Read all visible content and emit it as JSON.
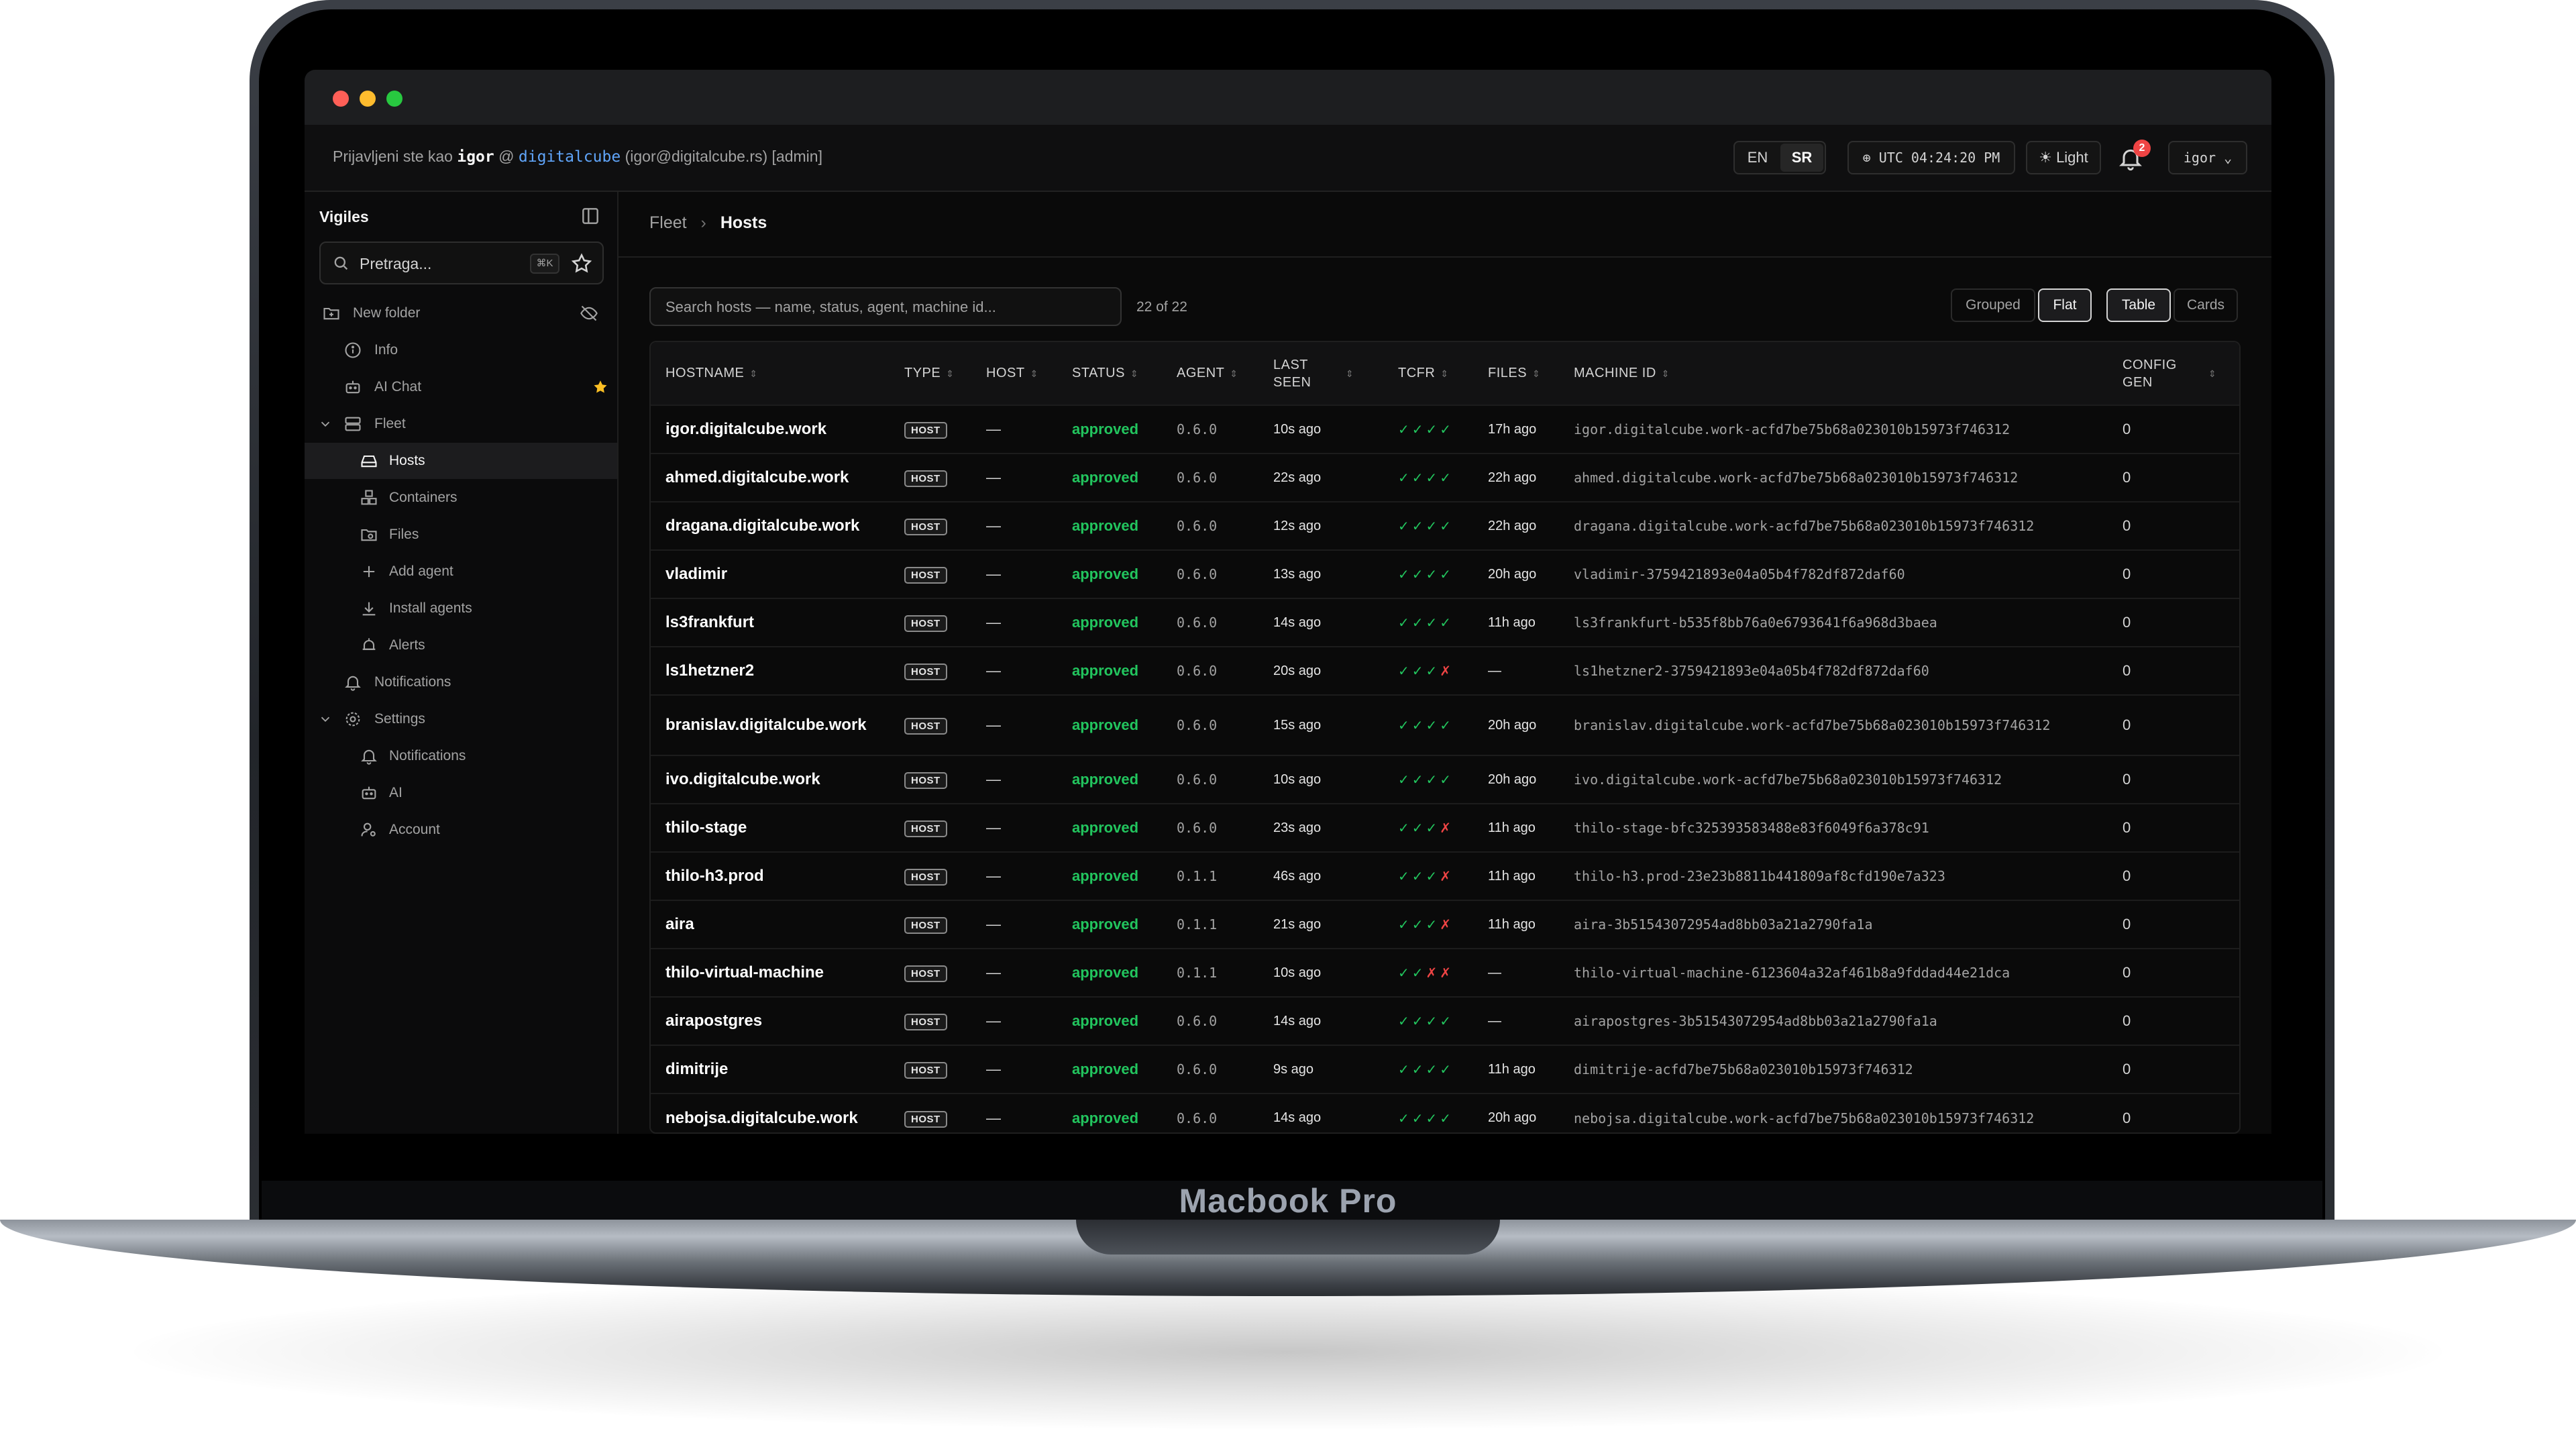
{
  "device": {
    "brand_label": "Macbook Pro"
  },
  "topbar": {
    "login_prefix": "Prijavljeni ste kao",
    "user": "igor",
    "at": "@",
    "org": "digitalcube",
    "email": "(igor@digitalcube.rs)",
    "role": "[admin]",
    "lang_en": "EN",
    "lang_sr": "SR",
    "clock": "UTC 04:24:20 PM",
    "theme": "Light",
    "notifications_count": "2",
    "user_menu": "igor"
  },
  "sidebar": {
    "app_name": "Vigiles",
    "search_placeholder": "Pretraga...",
    "search_shortcut": "⌘K",
    "items": [
      {
        "label": "New folder",
        "icon": "folder-plus-icon"
      },
      {
        "label": "Info",
        "icon": "info-icon"
      },
      {
        "label": "AI Chat",
        "icon": "bot-icon",
        "favorite": true
      },
      {
        "label": "Fleet",
        "icon": "server-icon",
        "expanded": true
      },
      {
        "label": "Hosts",
        "icon": "hard-drive-icon",
        "active": true
      },
      {
        "label": "Containers",
        "icon": "boxes-icon"
      },
      {
        "label": "Files",
        "icon": "folder-search-icon"
      },
      {
        "label": "Add agent",
        "icon": "plus-icon"
      },
      {
        "label": "Install agents",
        "icon": "download-icon"
      },
      {
        "label": "Alerts",
        "icon": "alarm-icon"
      },
      {
        "label": "Notifications",
        "icon": "bell-icon"
      },
      {
        "label": "Settings",
        "icon": "settings-icon",
        "expanded": true
      },
      {
        "label": "Notifications",
        "icon": "bell-icon"
      },
      {
        "label": "AI",
        "icon": "bot-icon"
      },
      {
        "label": "Account",
        "icon": "user-cog-icon"
      }
    ]
  },
  "main": {
    "breadcrumb_parent": "Fleet",
    "breadcrumb_sep": "›",
    "breadcrumb_current": "Hosts",
    "search_placeholder": "Search hosts — name, status, agent, machine id...",
    "count": "22 of 22",
    "view_grouped": "Grouped",
    "view_flat": "Flat",
    "mode_table": "Table",
    "mode_cards": "Cards"
  },
  "table": {
    "columns": [
      "HOSTNAME",
      "TYPE",
      "HOST",
      "STATUS",
      "AGENT",
      "LAST SEEN",
      "TCFR",
      "FILES",
      "MACHINE ID",
      "CONFIG GEN"
    ],
    "rows": [
      {
        "hostname": "igor.digitalcube.work",
        "type": "HOST",
        "host": "—",
        "status": "approved",
        "agent": "0.6.0",
        "last_seen": "10s ago",
        "tcfr": "✓✓✓✓",
        "files": "17h ago",
        "machine_id": "igor.digitalcube.work-acfd7be75b68a023010b15973f746312",
        "config_gen": "0"
      },
      {
        "hostname": "ahmed.digitalcube.work",
        "type": "HOST",
        "host": "—",
        "status": "approved",
        "agent": "0.6.0",
        "last_seen": "22s ago",
        "tcfr": "✓✓✓✓",
        "files": "22h ago",
        "machine_id": "ahmed.digitalcube.work-acfd7be75b68a023010b15973f746312",
        "config_gen": "0"
      },
      {
        "hostname": "dragana.digitalcube.work",
        "type": "HOST",
        "host": "—",
        "status": "approved",
        "agent": "0.6.0",
        "last_seen": "12s ago",
        "tcfr": "✓✓✓✓",
        "files": "22h ago",
        "machine_id": "dragana.digitalcube.work-acfd7be75b68a023010b15973f746312",
        "config_gen": "0"
      },
      {
        "hostname": "vladimir",
        "type": "HOST",
        "host": "—",
        "status": "approved",
        "agent": "0.6.0",
        "last_seen": "13s ago",
        "tcfr": "✓✓✓✓",
        "files": "20h ago",
        "machine_id": "vladimir-3759421893e04a05b4f782df872daf60",
        "config_gen": "0"
      },
      {
        "hostname": "ls3frankfurt",
        "type": "HOST",
        "host": "—",
        "status": "approved",
        "agent": "0.6.0",
        "last_seen": "14s ago",
        "tcfr": "✓✓✓✓",
        "files": "11h ago",
        "machine_id": "ls3frankfurt-b535f8bb76a0e6793641f6a968d3baea",
        "config_gen": "0"
      },
      {
        "hostname": "ls1hetzner2",
        "type": "HOST",
        "host": "—",
        "status": "approved",
        "agent": "0.6.0",
        "last_seen": "20s ago",
        "tcfr": "✓✓✓✗",
        "files": "—",
        "machine_id": "ls1hetzner2-3759421893e04a05b4f782df872daf60",
        "config_gen": "0"
      },
      {
        "hostname": "branislav.digitalcube.work",
        "type": "HOST",
        "host": "—",
        "status": "approved",
        "agent": "0.6.0",
        "last_seen": "15s ago",
        "tcfr": "✓✓✓✓",
        "files": "20h ago",
        "machine_id": "branislav.digitalcube.work-acfd7be75b68a023010b15973f746312",
        "config_gen": "0"
      },
      {
        "hostname": "ivo.digitalcube.work",
        "type": "HOST",
        "host": "—",
        "status": "approved",
        "agent": "0.6.0",
        "last_seen": "10s ago",
        "tcfr": "✓✓✓✓",
        "files": "20h ago",
        "machine_id": "ivo.digitalcube.work-acfd7be75b68a023010b15973f746312",
        "config_gen": "0"
      },
      {
        "hostname": "thilo-stage",
        "type": "HOST",
        "host": "—",
        "status": "approved",
        "agent": "0.6.0",
        "last_seen": "23s ago",
        "tcfr": "✓✓✓✗",
        "files": "11h ago",
        "machine_id": "thilo-stage-bfc325393583488e83f6049f6a378c91",
        "config_gen": "0"
      },
      {
        "hostname": "thilo-h3.prod",
        "type": "HOST",
        "host": "—",
        "status": "approved",
        "agent": "0.1.1",
        "last_seen": "46s ago",
        "tcfr": "✓✓✓✗",
        "files": "11h ago",
        "machine_id": "thilo-h3.prod-23e23b8811b441809af8cfd190e7a323",
        "config_gen": "0"
      },
      {
        "hostname": "aira",
        "type": "HOST",
        "host": "—",
        "status": "approved",
        "agent": "0.1.1",
        "last_seen": "21s ago",
        "tcfr": "✓✓✓✗",
        "files": "11h ago",
        "machine_id": "aira-3b51543072954ad8bb03a21a2790fa1a",
        "config_gen": "0"
      },
      {
        "hostname": "thilo-virtual-machine",
        "type": "HOST",
        "host": "—",
        "status": "approved",
        "agent": "0.1.1",
        "last_seen": "10s ago",
        "tcfr": "✓✓✗✗",
        "files": "—",
        "machine_id": "thilo-virtual-machine-6123604a32af461b8a9fddad44e21dca",
        "config_gen": "0"
      },
      {
        "hostname": "airapostgres",
        "type": "HOST",
        "host": "—",
        "status": "approved",
        "agent": "0.6.0",
        "last_seen": "14s ago",
        "tcfr": "✓✓✓✓",
        "files": "—",
        "machine_id": "airapostgres-3b51543072954ad8bb03a21a2790fa1a",
        "config_gen": "0"
      },
      {
        "hostname": "dimitrije",
        "type": "HOST",
        "host": "—",
        "status": "approved",
        "agent": "0.6.0",
        "last_seen": "9s ago",
        "tcfr": "✓✓✓✓",
        "files": "11h ago",
        "machine_id": "dimitrije-acfd7be75b68a023010b15973f746312",
        "config_gen": "0"
      },
      {
        "hostname": "nebojsa.digitalcube.work",
        "type": "HOST",
        "host": "—",
        "status": "approved",
        "agent": "0.6.0",
        "last_seen": "14s ago",
        "tcfr": "✓✓✓✓",
        "files": "20h ago",
        "machine_id": "nebojsa.digitalcube.work-acfd7be75b68a023010b15973f746312",
        "config_gen": "0"
      }
    ]
  },
  "colors": {
    "status_ok": "#22c55e",
    "status_fail": "#ef4444",
    "accent_link": "#60a5fa",
    "favorite": "#fbbf24"
  }
}
